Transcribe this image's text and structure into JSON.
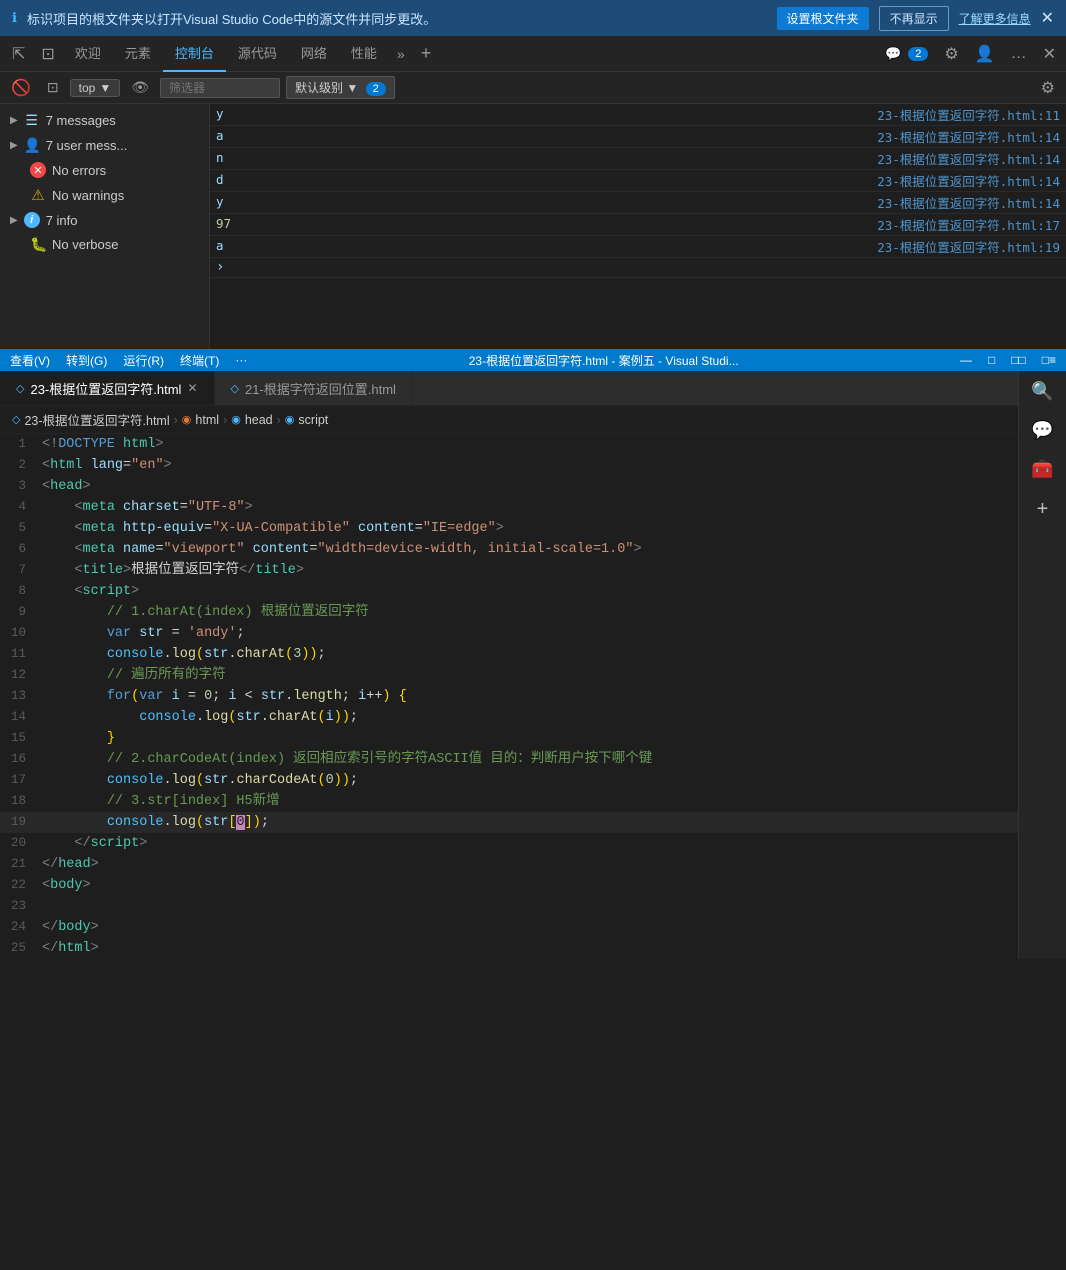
{
  "notif": {
    "icon": "ℹ",
    "text": "标识项目的根文件夹以打开Visual Studio Code中的源文件并同步更改。",
    "btn1": "设置根文件夹",
    "btn2": "不再显示",
    "link": "了解更多信息",
    "close": "✕"
  },
  "devtools": {
    "tabs": [
      {
        "label": "欢迎",
        "active": false
      },
      {
        "label": "元素",
        "active": false
      },
      {
        "label": "控制台",
        "active": true
      },
      {
        "label": "源代码",
        "active": false
      },
      {
        "label": "网络",
        "active": false
      },
      {
        "label": "性能",
        "active": false
      }
    ],
    "more_icon": "»",
    "add_icon": "+",
    "chat_badge": "2",
    "settings_icon": "⚙",
    "profile_icon": "👤",
    "more2_icon": "…",
    "close_icon": "✕"
  },
  "console_toolbar": {
    "clear_icon": "🚫",
    "filter_icon": "🔽",
    "top_label": "top",
    "chevron": "▼",
    "eye_icon": "👁",
    "filter_placeholder": "筛选器",
    "level_label": "默认级别",
    "level_chevron": "▼",
    "badge": "2",
    "settings_icon": "⚙"
  },
  "sidebar": {
    "items": [
      {
        "icon": "▶",
        "label": "7 messages",
        "type": "messages",
        "count": null
      },
      {
        "icon": "▶",
        "label": "7 user mess...",
        "type": "user-messages"
      },
      {
        "icon": "✕",
        "label": "No errors",
        "type": "errors"
      },
      {
        "icon": "⚠",
        "label": "No warnings",
        "type": "warnings"
      },
      {
        "icon": "▶",
        "label": "7 info",
        "type": "info-items"
      },
      {
        "icon": "🐛",
        "label": "No verbose",
        "type": "verbose"
      }
    ]
  },
  "console_output": {
    "rows": [
      {
        "val": "y",
        "file": "23-根据位置返回字符.html:11",
        "type": "text"
      },
      {
        "val": "a",
        "file": "23-根据位置返回字符.html:14",
        "type": "text"
      },
      {
        "val": "n",
        "file": "23-根据位置返回字符.html:14",
        "type": "text"
      },
      {
        "val": "d",
        "file": "23-根据位置返回字符.html:14",
        "type": "text"
      },
      {
        "val": "y",
        "file": "23-根据位置返回字符.html:14",
        "type": "text"
      },
      {
        "val": "97",
        "file": "23-根据位置返回字符.html:17",
        "type": "num"
      },
      {
        "val": "a",
        "file": "23-根据位置返回字符.html:19",
        "type": "text"
      },
      {
        "val": ">",
        "file": "",
        "type": "expand"
      }
    ]
  },
  "status_bar": {
    "items": [
      "查看(V)",
      "转到(G)",
      "运行(R)",
      "终端(T)",
      "···"
    ],
    "title": "23-根据位置返回字符.html - 案例五 - Visual Studi...",
    "win_icons": [
      "□",
      "□",
      "□□",
      "□≡",
      "—"
    ]
  },
  "editor": {
    "tabs": [
      {
        "label": "23-根据位置返回字符.html",
        "active": true,
        "icon": "◇",
        "close": "✕"
      },
      {
        "label": "21-根据字符返回位置.html",
        "active": false,
        "icon": "◇"
      }
    ],
    "breadcrumb": [
      {
        "icon": "◇",
        "text": "23-根据位置返回字符.html"
      },
      {
        "icon": "◉",
        "text": "html"
      },
      {
        "icon": "◉",
        "text": "head"
      },
      {
        "icon": "◉",
        "text": "script"
      }
    ]
  },
  "code": {
    "lines": [
      {
        "num": 1,
        "content": "<span class='lt'>&lt;</span><span class='kw'>!DOCTYPE</span><span class='tag'> html</span><span class='lt'>&gt;</span>"
      },
      {
        "num": 2,
        "content": "<span class='lt'>&lt;</span><span class='tag'>html</span> <span class='attr'>lang</span><span class='op'>=</span><span class='str'>\"en\"</span><span class='lt'>&gt;</span>"
      },
      {
        "num": 3,
        "content": "<span class='lt'>&lt;</span><span class='tag'>head</span><span class='lt'>&gt;</span>"
      },
      {
        "num": 4,
        "content": "    <span class='lt'>&lt;</span><span class='tag'>meta</span> <span class='attr'>charset</span><span class='op'>=</span><span class='str'>\"UTF-8\"</span><span class='lt'>&gt;</span>"
      },
      {
        "num": 5,
        "content": "    <span class='lt'>&lt;</span><span class='tag'>meta</span> <span class='attr'>http-equiv</span><span class='op'>=</span><span class='str'>\"X-UA-Compatible\"</span> <span class='attr'>content</span><span class='op'>=</span><span class='str'>\"IE=edge\"</span><span class='lt'>&gt;</span>"
      },
      {
        "num": 6,
        "content": "    <span class='lt'>&lt;</span><span class='tag'>meta</span> <span class='attr'>name</span><span class='op'>=</span><span class='str'>\"viewport\"</span> <span class='attr'>content</span><span class='op'>=</span><span class='str'>\"width=device-width, initial-scale=1.0\"</span><span class='lt'>&gt;</span>"
      },
      {
        "num": 7,
        "content": "    <span class='lt'>&lt;</span><span class='tag'>title</span><span class='lt'>&gt;</span><span class='op'>根据位置返回字符</span><span class='lt'>&lt;/</span><span class='tag'>title</span><span class='lt'>&gt;</span>"
      },
      {
        "num": 8,
        "content": "    <span class='lt'>&lt;</span><span class='tag'>script</span><span class='lt'>&gt;</span>"
      },
      {
        "num": 9,
        "content": "        <span class='comment'>// 1.charAt(index) 根据位置返回字符</span>"
      },
      {
        "num": 10,
        "content": "        <span class='kw'>var</span> <span class='var'>str</span> <span class='op'>=</span> <span class='str'>'andy'</span><span class='op'>;</span>"
      },
      {
        "num": 11,
        "content": "        <span class='cn'>console</span><span class='op'>.</span><span class='fn'>log</span><span class='bracket'>(</span><span class='var'>str</span><span class='op'>.</span><span class='fn'>charAt</span><span class='bracket'>(</span><span class='num'>3</span><span class='bracket'>))</span><span class='op'>;</span>"
      },
      {
        "num": 12,
        "content": "        <span class='comment'>// 遍历所有的字符</span>"
      },
      {
        "num": 13,
        "content": "        <span class='kw'>for</span><span class='bracket'>(</span><span class='kw'>var</span> <span class='var'>i</span> <span class='op'>=</span> <span class='num'>0</span><span class='op'>;</span> <span class='var'>i</span> <span class='op'>&lt;</span> <span class='var'>str</span><span class='op'>.</span><span class='fn'>length</span><span class='op'>;</span> <span class='var'>i</span><span class='op'>++</span><span class='bracket'>)</span> <span class='bracket'>{</span>"
      },
      {
        "num": 14,
        "content": "            <span class='cn'>console</span><span class='op'>.</span><span class='fn'>log</span><span class='bracket'>(</span><span class='var'>str</span><span class='op'>.</span><span class='fn'>charAt</span><span class='bracket'>(</span><span class='var'>i</span><span class='bracket'>))</span><span class='op'>;</span>"
      },
      {
        "num": 15,
        "content": "        <span class='bracket'>}</span>"
      },
      {
        "num": 16,
        "content": "        <span class='comment'>// 2.charCodeAt(index) 返回相应索引号的字符ASCII值 目的：判断用户按下哪个键</span>"
      },
      {
        "num": 17,
        "content": "        <span class='cn'>console</span><span class='op'>.</span><span class='fn'>log</span><span class='bracket'>(</span><span class='var'>str</span><span class='op'>.</span><span class='fn'>charCodeAt</span><span class='bracket'>(</span><span class='num'>0</span><span class='bracket'>))</span><span class='op'>;</span>"
      },
      {
        "num": 18,
        "content": "        <span class='comment'>// 3.str[index] H5新增</span>"
      },
      {
        "num": 19,
        "content": "        <span class='cn'>console</span><span class='op'>.</span><span class='fn'>log</span><span class='bracket'>(</span><span class='var'>str</span><span class='bracket'>[</span><span class='cursor-highlight'>0</span><span class='bracket'>]</span><span class='bracket'>)</span><span class='op'>;</span>"
      },
      {
        "num": 20,
        "content": "    <span class='lt'>&lt;/</span><span class='tag'>script</span><span class='lt'>&gt;</span>"
      },
      {
        "num": 21,
        "content": "<span class='lt'>&lt;/</span><span class='tag'>head</span><span class='lt'>&gt;</span>"
      },
      {
        "num": 22,
        "content": "<span class='lt'>&lt;</span><span class='tag'>body</span><span class='lt'>&gt;</span>"
      },
      {
        "num": 23,
        "content": ""
      },
      {
        "num": 24,
        "content": "<span class='lt'>&lt;/</span><span class='tag'>body</span><span class='lt'>&gt;</span>"
      },
      {
        "num": 25,
        "content": "<span class='lt'>&lt;/</span><span class='tag'>html</span><span class='lt'>&gt;</span>"
      }
    ]
  },
  "right_panel": {
    "icons": [
      "🔍",
      "💬",
      "🧰",
      "+"
    ]
  }
}
